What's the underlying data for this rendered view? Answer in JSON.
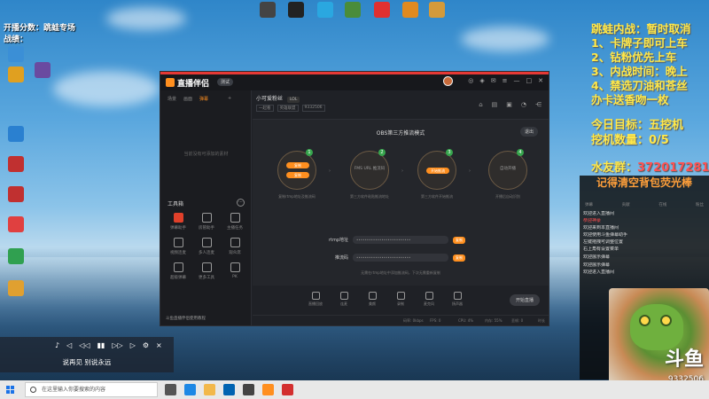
{
  "desktop": {
    "top_icons": [
      {
        "label": "",
        "color": "#444"
      },
      {
        "label": "",
        "color": "#222"
      },
      {
        "label": "",
        "color": "#2aa7e0"
      },
      {
        "label": "",
        "color": "#4a8c3a"
      },
      {
        "label": "",
        "color": "#e03030"
      },
      {
        "label": "",
        "color": "#e08a20"
      },
      {
        "label": "",
        "color": "#d49a3a"
      }
    ],
    "left_icons": [
      {
        "label": "",
        "color": "#3b8fd6"
      },
      {
        "label": "",
        "color": "#e0a020"
      },
      {
        "label": "",
        "color": "#6a4aa0"
      },
      {
        "label": "",
        "color": "#2a80d0"
      },
      {
        "label": "",
        "color": "#c03030"
      },
      {
        "label": "",
        "color": "#c03030"
      },
      {
        "label": "",
        "color": "#e04040"
      },
      {
        "label": "",
        "color": "#30a050"
      },
      {
        "label": "",
        "color": "#e0a030"
      }
    ]
  },
  "overlay_left": {
    "line1": "开播分数：跳蛙专场",
    "line2": "战绩："
  },
  "overlay_right": {
    "lines": [
      "跳蛙内战：暂时取消",
      "1、卡牌子即可上车",
      "2、钻粉优先上车",
      "3、内战时间：晚上",
      "4、禁选刀油和苍丝",
      "办卡送香吻一枚"
    ],
    "target_line": "今日目标：五挖机",
    "count_line": "挖机数量：0/5",
    "fans_label": "水友群：",
    "fans_number": "372017281"
  },
  "chat": {
    "title": "记得清空背包荧光棒",
    "tabs": [
      "弹幕",
      "贡献",
      "在线",
      "粉丝"
    ],
    "lines": [
      {
        "text": "欢迎进入直播间",
        "red": false
      },
      {
        "text": "恭迎神豪",
        "red": true
      },
      {
        "text": "欢迎来到本直播间",
        "red": false
      },
      {
        "text": "欢迎使用斗鱼弹幕助手",
        "red": false
      },
      {
        "text": "左键拖拽可调整位置",
        "red": false
      },
      {
        "text": "右上角有设置菜单",
        "red": false
      },
      {
        "text": "",
        "red": false
      },
      {
        "text": "欢迎展示弹幕",
        "red": false
      },
      {
        "text": "",
        "red": false
      },
      {
        "text": "欢迎展示弹幕",
        "red": false
      },
      {
        "text": "欢迎进入直播间",
        "red": false
      }
    ]
  },
  "mascot": {
    "brand": "斗鱼",
    "room_id": "9332506"
  },
  "app": {
    "title": "直播伴侣",
    "version_badge": "测试",
    "sidebar_tabs": [
      "场景",
      "画面",
      "弹幕"
    ],
    "sidebar_active": 2,
    "side_empty": "当前没有可添加的素材",
    "toolbox_label": "工具箱",
    "tools": [
      {
        "label": "弹幕助手",
        "hot": true
      },
      {
        "label": "房管助手",
        "hot": false
      },
      {
        "label": "主播任务",
        "hot": false
      },
      {
        "label": "视频连麦",
        "hot": false
      },
      {
        "label": "多人连麦",
        "hot": false
      },
      {
        "label": "观众席",
        "hot": false
      },
      {
        "label": "超级弹幕",
        "hot": false
      },
      {
        "label": "更多工具",
        "hot": false
      },
      {
        "label": "PK",
        "hot": false
      }
    ],
    "side_note": "斗鱼直播伴侣使用教程",
    "room_name": "小可爱粉丝",
    "room_tag": "LOL",
    "room_sub": [
      "一起看",
      "英雄联盟",
      "9332506"
    ],
    "mode_title": "OBS第三方推流模式",
    "exit_label": "退出",
    "steps": [
      {
        "num": "1",
        "inner": "",
        "pill": "复制",
        "caption": "复制rtmp地址及推流码"
      },
      {
        "num": "2",
        "inner": "FMS URL 推流码",
        "pill": "",
        "caption": "第三方软件粘贴推流地址"
      },
      {
        "num": "3",
        "inner": "",
        "pill": "开始推流",
        "caption": "第三方软件开始推流"
      },
      {
        "num": "4",
        "inner": "自动开播",
        "pill": "",
        "caption": "开播后自动识别"
      }
    ],
    "rtmp_label": "rtmp地址",
    "rtmp_value": "••••••••••••••••••••••••••",
    "key_label": "推流码",
    "key_value": "••••••••••••••••••••••••••",
    "copy_label": "复制",
    "hint": "无需在rtmp地址中添加推流码，下次无需重新复制",
    "bottom_items": [
      "直播回放",
      "连麦",
      "美颜",
      "录制",
      "麦克风",
      "扬声器"
    ],
    "start_label": "开始直播",
    "status": [
      "码率: 0kbps",
      "FPS: 0",
      "CPU: 4%",
      "内存: 55%",
      "丢帧: 0",
      "时长"
    ]
  },
  "player": {
    "controls": [
      "♪",
      "◁",
      "◁◁",
      "▮▮",
      "▷▷",
      "▷",
      "⚙",
      "×"
    ],
    "lyric": "说再见 别说永远"
  },
  "taskbar": {
    "search_placeholder": "在这里输入你要搜索的内容",
    "apps": [
      {
        "name": "task-view",
        "color": "#555"
      },
      {
        "name": "edge",
        "color": "#1e88e5"
      },
      {
        "name": "explorer",
        "color": "#f2b84b"
      },
      {
        "name": "store",
        "color": "#0063b1"
      },
      {
        "name": "mail",
        "color": "#444"
      },
      {
        "name": "douyu-companion",
        "color": "#ff8f1f"
      },
      {
        "name": "netease-music",
        "color": "#d32f2f"
      }
    ]
  }
}
